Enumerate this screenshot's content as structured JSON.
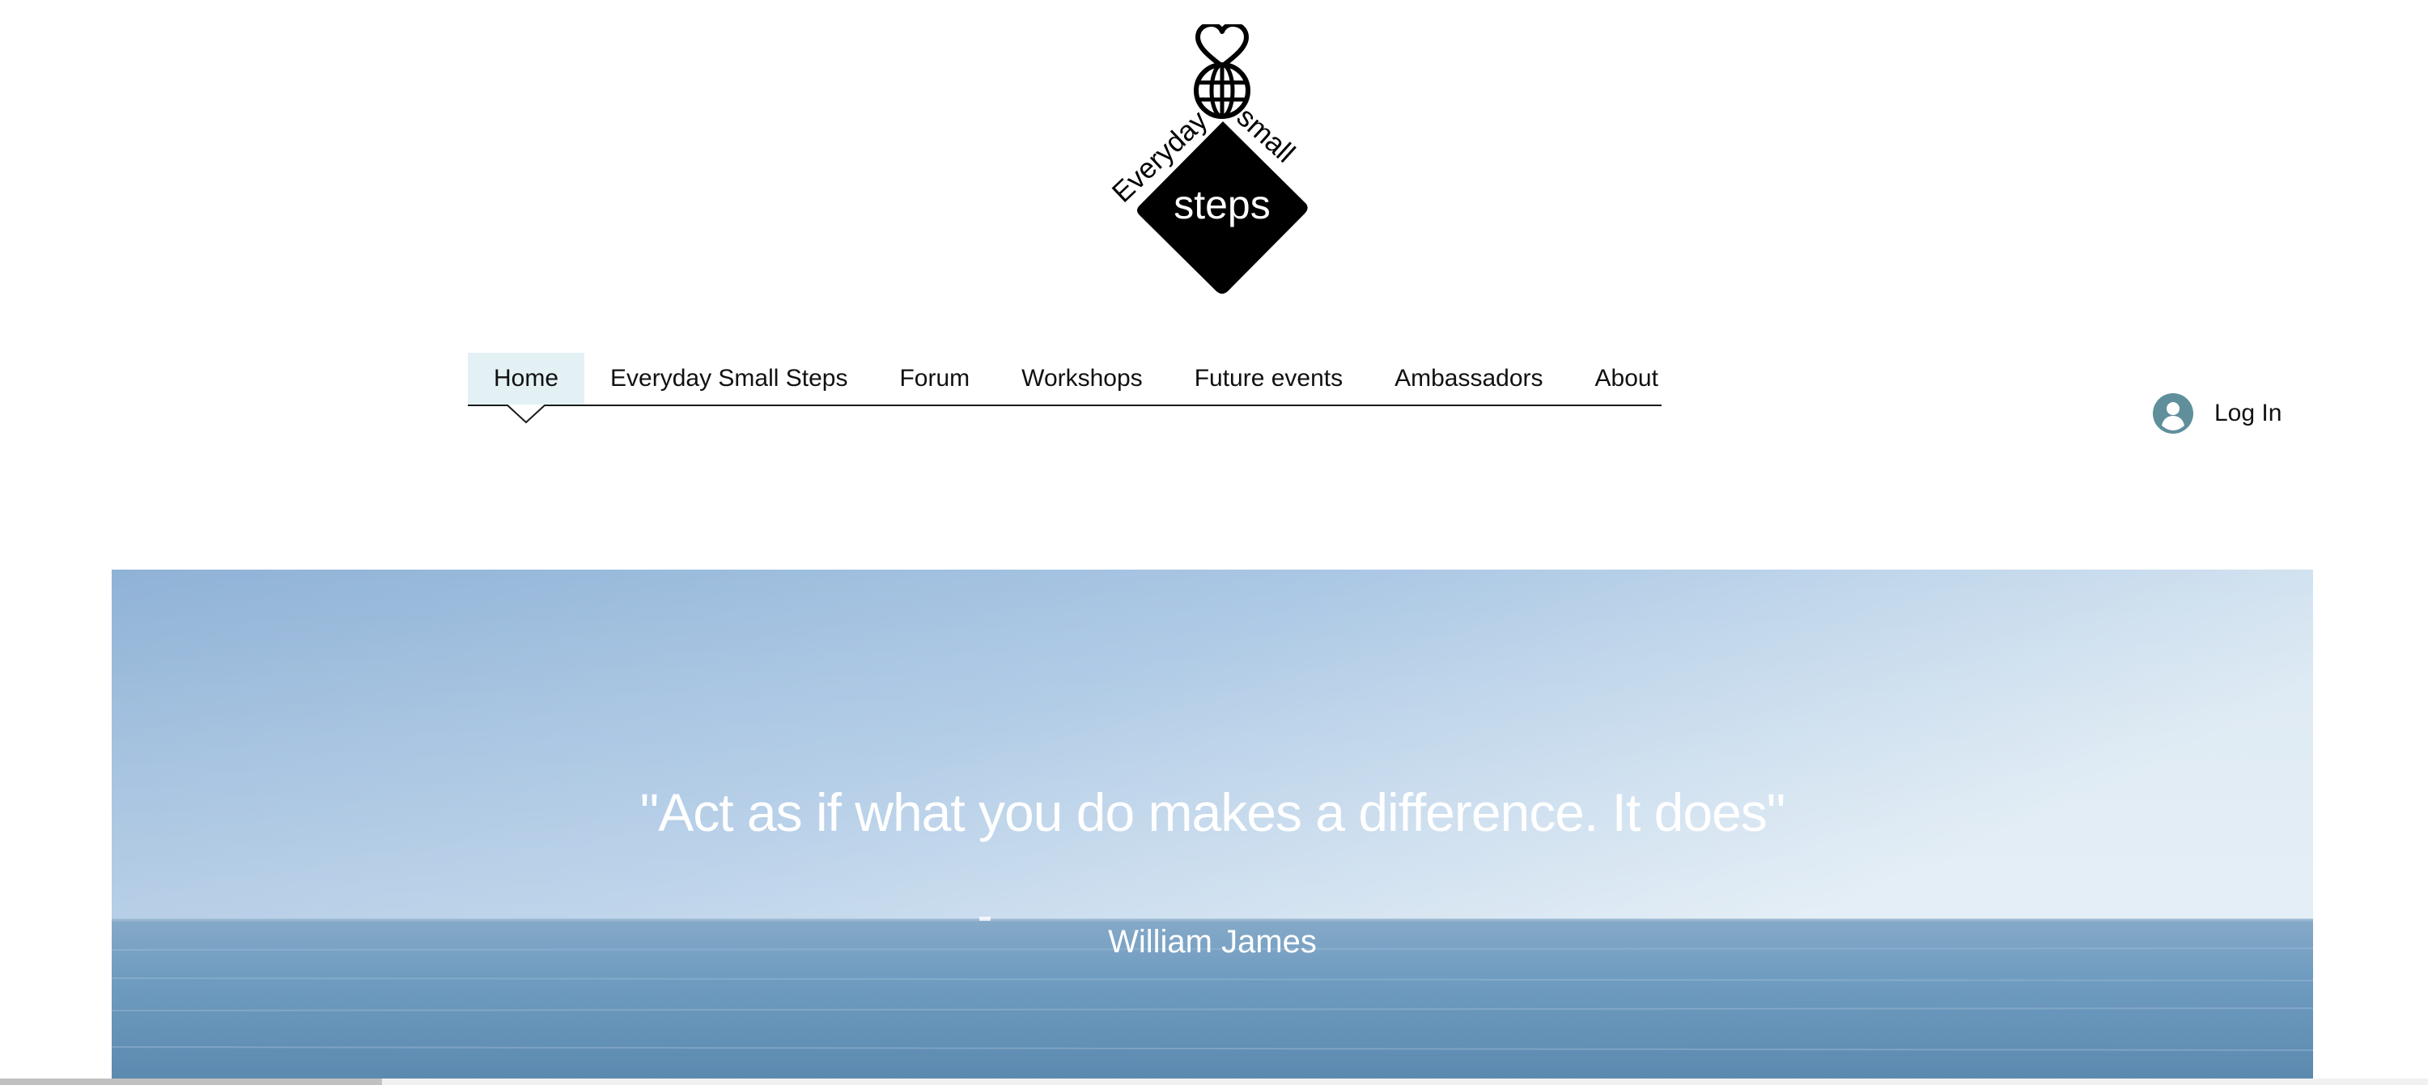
{
  "logo": {
    "top_word_left": "Everyday",
    "top_word_right": "small",
    "center_word": "steps",
    "icon": "heart-globe-icon"
  },
  "nav": {
    "items": [
      {
        "label": "Home",
        "active": true
      },
      {
        "label": "Everyday Small Steps",
        "active": false
      },
      {
        "label": "Forum",
        "active": false
      },
      {
        "label": "Workshops",
        "active": false
      },
      {
        "label": "Future events",
        "active": false
      },
      {
        "label": "Ambassadors",
        "active": false
      },
      {
        "label": "About",
        "active": false
      }
    ],
    "active_color": "#e3f1f5"
  },
  "login": {
    "label": "Log In",
    "icon": "user-avatar-icon",
    "icon_color": "#5f8f9a"
  },
  "hero": {
    "quote": "\"Act as if what you do makes a difference. It does\"",
    "author": "William James",
    "sky_color": "#a9c6e2",
    "sea_color": "#6f9cc0"
  }
}
